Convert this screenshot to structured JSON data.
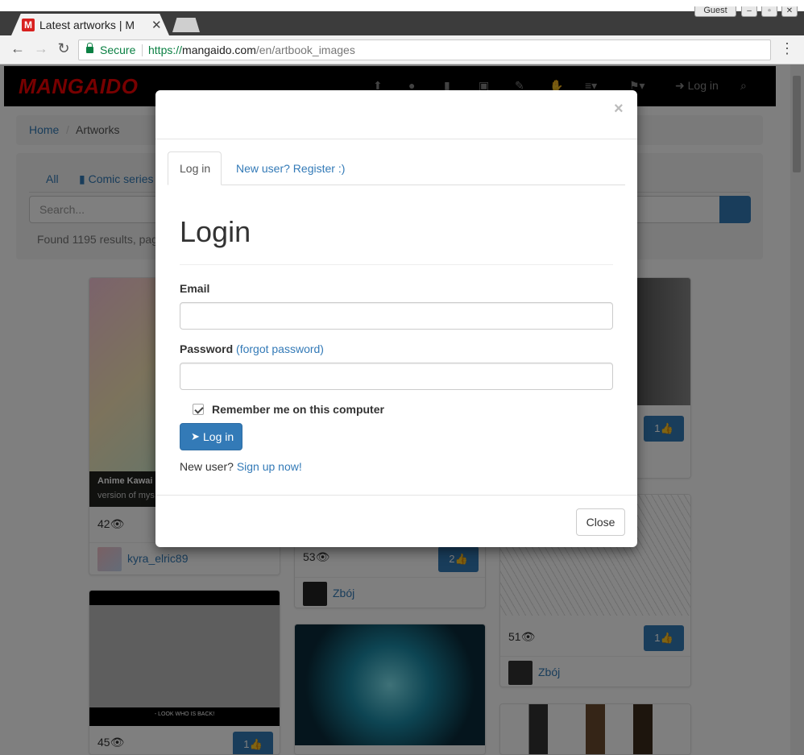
{
  "browser": {
    "tab_title": "Latest artworks | M",
    "tab_favicon": "M",
    "window_user": "Guest",
    "secure_label": "Secure",
    "url_scheme": "https://",
    "url_host": "mangaido.com",
    "url_path": "/en/artbook_images"
  },
  "site": {
    "logo": "MANGAIDO",
    "nav_icons": [
      "upload-icon",
      "comments-icon",
      "book-icon",
      "image-icon",
      "edit-icon",
      "hand-icon",
      "menu-icon",
      "flag-icon"
    ],
    "login_link": "Log in",
    "breadcrumb": {
      "home": "Home",
      "separator": "/",
      "current": "Artworks"
    },
    "filters": {
      "all": "All",
      "comic": "Comic series"
    },
    "search_placeholder": "Search...",
    "found_text": "Found 1195 results, pag"
  },
  "cards": [
    {
      "caption_title": "Anime Kawai",
      "caption_text": "version of mys",
      "views": "42",
      "author": "kyra_elric89"
    },
    {
      "views": "53",
      "likes": "2",
      "author": "Zbój"
    },
    {
      "likes": "1"
    },
    {
      "views": "51",
      "likes": "1",
      "author": "Zbój"
    },
    {
      "views": "45",
      "likes": "1"
    },
    {
      "overlay_text": "- LOOK WHO IS BACK!"
    }
  ],
  "modal": {
    "tabs": {
      "login": "Log in",
      "register": "New user? Register :)"
    },
    "title": "Login",
    "email_label": "Email",
    "password_label": "Password",
    "forgot_link": "(forgot password)",
    "remember_label": "Remember me on this computer",
    "submit_label": "Log in",
    "newuser_prefix": "New user?",
    "signup_link": "Sign up now!",
    "close_label": "Close",
    "close_x": "×"
  },
  "colors": {
    "brand_red": "#e00000",
    "primary": "#337ab7",
    "nav_bg": "#000000"
  }
}
